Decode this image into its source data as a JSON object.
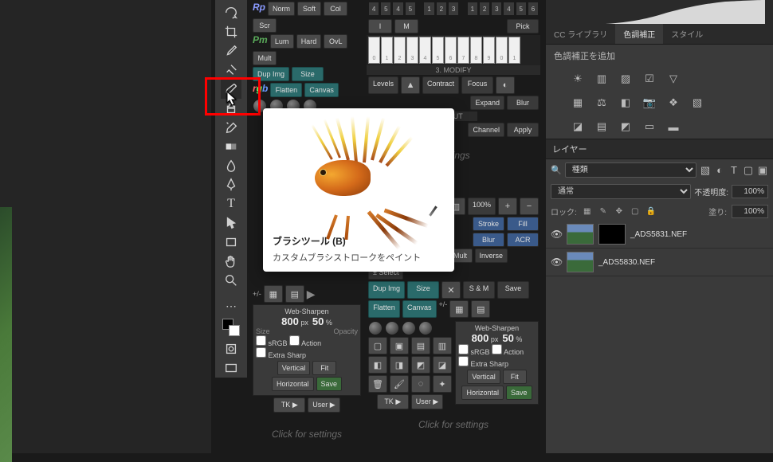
{
  "tooltip": {
    "title": "ブラシツール (B)",
    "desc": "カスタムブラシストロークをペイント"
  },
  "panel_buttons": {
    "norm": "Norm",
    "soft": "Soft",
    "col": "Col",
    "scr": "Scr",
    "lum": "Lum",
    "hard": "Hard",
    "ovl": "OvL",
    "mult": "Mult",
    "dupimg": "Dup Img",
    "size": "Size",
    "flatten": "Flatten",
    "canvas": "Canvas",
    "pick": "Pick",
    "i": "I",
    "m": "M",
    "contract": "Contract",
    "focus": "Focus",
    "expand": "Expand",
    "blur": "Blur",
    "channel": "Channel",
    "apply": "Apply",
    "stroke": "Stroke",
    "fill": "Fill",
    "acr": "ACR",
    "inverse": "Inverse",
    "pmselect": "± Select",
    "sandm": "S & M",
    "save": "Save",
    "vertical": "Vertical",
    "fit": "Fit",
    "horizontal": "Horizontal",
    "tk": "TK ▶",
    "user": "User ▶",
    "levels": "Levels",
    "modify": "3. MODIFY",
    "tput": "TPUT",
    "settings": "settings",
    "websharp": "Web-Sharpen",
    "srgb": "sRGB",
    "action": "Action",
    "extra": "Extra Sharp",
    "sharp800": "800",
    "px": "px",
    "pct50": "50",
    "pct": "%",
    "sizelbl": "Size",
    "opacitylbl": "Opacity",
    "click": "Click for settings",
    "hundred": "100%",
    "pm": "+/-"
  },
  "black_keys": [
    "4",
    "5",
    "4",
    "5",
    " ",
    "1",
    "2",
    "3",
    " ",
    "1",
    "2",
    "3",
    "4",
    "5",
    "6"
  ],
  "white_keys": [
    "0",
    "1",
    "2",
    "3",
    "4",
    "5",
    "6",
    "7",
    "8",
    "9",
    "0",
    "1"
  ],
  "right": {
    "tab1": "CC ライブラリ",
    "tab2": "色調補正",
    "tab3": "スタイル",
    "adjust_add": "色調補正を追加",
    "layers": "レイヤー",
    "kind": "種類",
    "blend": "通常",
    "opacity_label": "不透明度:",
    "opacity_val": "100%",
    "lock": "ロック:",
    "fill_label": "塗り:",
    "fill_val": "100%",
    "layer1": "_ADS5831.NEF",
    "layer2": "_ADS5830.NEF"
  }
}
